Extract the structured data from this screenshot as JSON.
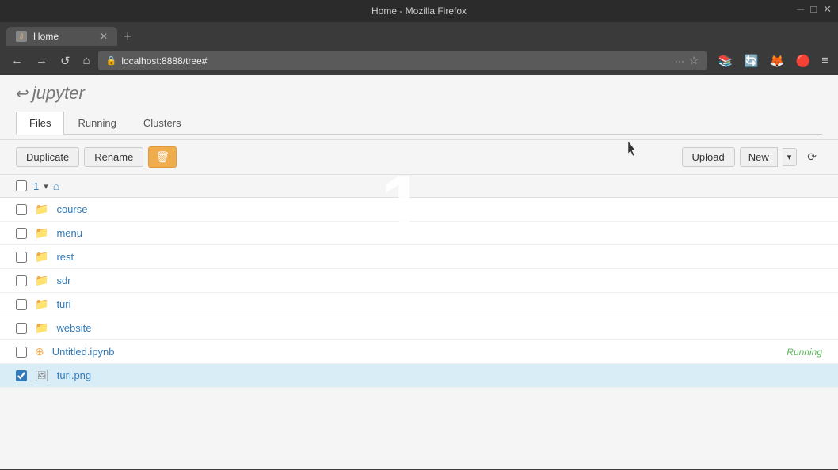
{
  "titlebar": {
    "title": "Home - Mozilla Firefox"
  },
  "browser": {
    "tab_title": "Home",
    "url": "localhost:8888/tree#",
    "new_tab_label": "+",
    "nav": {
      "back": "←",
      "forward": "→",
      "reload": "↺",
      "home": "⌂",
      "more": "···",
      "bookmark": "☆",
      "bookmarks_icon": "♡",
      "history_icon": "📚",
      "sync_icon": "🔄",
      "menu": "≡"
    }
  },
  "jupyter": {
    "logo_icon": "↩",
    "logo_text": "jupyter",
    "tabs": [
      {
        "label": "Files",
        "active": true
      },
      {
        "label": "Running",
        "active": false
      },
      {
        "label": "Clusters",
        "active": false
      }
    ],
    "toolbar": {
      "duplicate_label": "Duplicate",
      "rename_label": "Rename",
      "upload_label": "Upload",
      "new_label": "New",
      "refresh_label": "⟳"
    },
    "breadcrumb": {
      "number": "1",
      "home_icon": "⌂"
    },
    "files": [
      {
        "type": "folder",
        "name": "course",
        "running": false,
        "selected": false
      },
      {
        "type": "folder",
        "name": "menu",
        "running": false,
        "selected": false
      },
      {
        "type": "folder",
        "name": "rest",
        "running": false,
        "selected": false
      },
      {
        "type": "folder",
        "name": "sdr",
        "running": false,
        "selected": false
      },
      {
        "type": "folder",
        "name": "turi",
        "running": false,
        "selected": false
      },
      {
        "type": "folder",
        "name": "website",
        "running": false,
        "selected": false
      },
      {
        "type": "notebook",
        "name": "Untitled.ipynb",
        "running": true,
        "selected": false
      },
      {
        "type": "image",
        "name": "turi.png",
        "running": false,
        "selected": true
      }
    ],
    "running_badge": "Running"
  },
  "big_number": "1"
}
